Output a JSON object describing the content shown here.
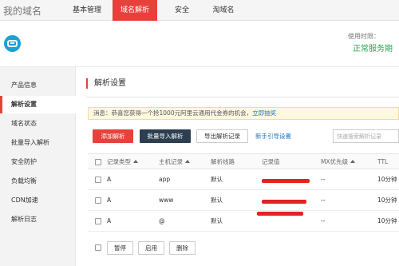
{
  "header": {
    "brand": "我的域名",
    "nav": [
      {
        "label": "基本管理",
        "active": false
      },
      {
        "label": "域名解析",
        "active": true
      },
      {
        "label": "安全",
        "active": false
      },
      {
        "label": "淘域名",
        "active": false
      }
    ]
  },
  "service": {
    "label": "使用时限：",
    "status": "正常服务期"
  },
  "sidebar": {
    "items": [
      {
        "label": "产品信息",
        "active": false
      },
      {
        "label": "解析设置",
        "active": true
      },
      {
        "label": "域名状态",
        "active": false
      },
      {
        "label": "批量导入解析",
        "active": false
      },
      {
        "label": "安全防护",
        "active": false
      },
      {
        "label": "负载均衡",
        "active": false
      },
      {
        "label": "CDN加速",
        "active": false
      },
      {
        "label": "解析日志",
        "active": false
      }
    ]
  },
  "main": {
    "title": "解析设置",
    "notice": {
      "text": "消息：恭喜您获得一个抢1000元阿里云通用代金券的机会，",
      "link": "立即抽奖"
    },
    "toolbar": {
      "add_label": "添加解析",
      "import_label": "批量导入解析",
      "export_label": "导出解析记录",
      "guide_label": "新手引导设置",
      "search_placeholder": "快速搜索解析记录"
    },
    "table": {
      "columns": [
        "记录类型",
        "主机记录",
        "解析线路",
        "记录值",
        "MX优先级",
        "TTL"
      ],
      "rows": [
        {
          "type": "A",
          "host": "app",
          "line": "默认",
          "mx": "--",
          "ttl": "10分钟"
        },
        {
          "type": "A",
          "host": "www",
          "line": "默认",
          "mx": "--",
          "ttl": "10分钟"
        },
        {
          "type": "A",
          "host": "@",
          "line": "默认",
          "mx": "--",
          "ttl": "10分钟"
        }
      ]
    },
    "batch": {
      "pause_label": "暂停",
      "enable_label": "启用",
      "delete_label": "删除"
    }
  },
  "colors": {
    "accent": "#e8413c",
    "dark_button": "#2c3e50",
    "status_green": "#24a654",
    "link": "#1a73c8",
    "logo": "#1aa1d6"
  }
}
